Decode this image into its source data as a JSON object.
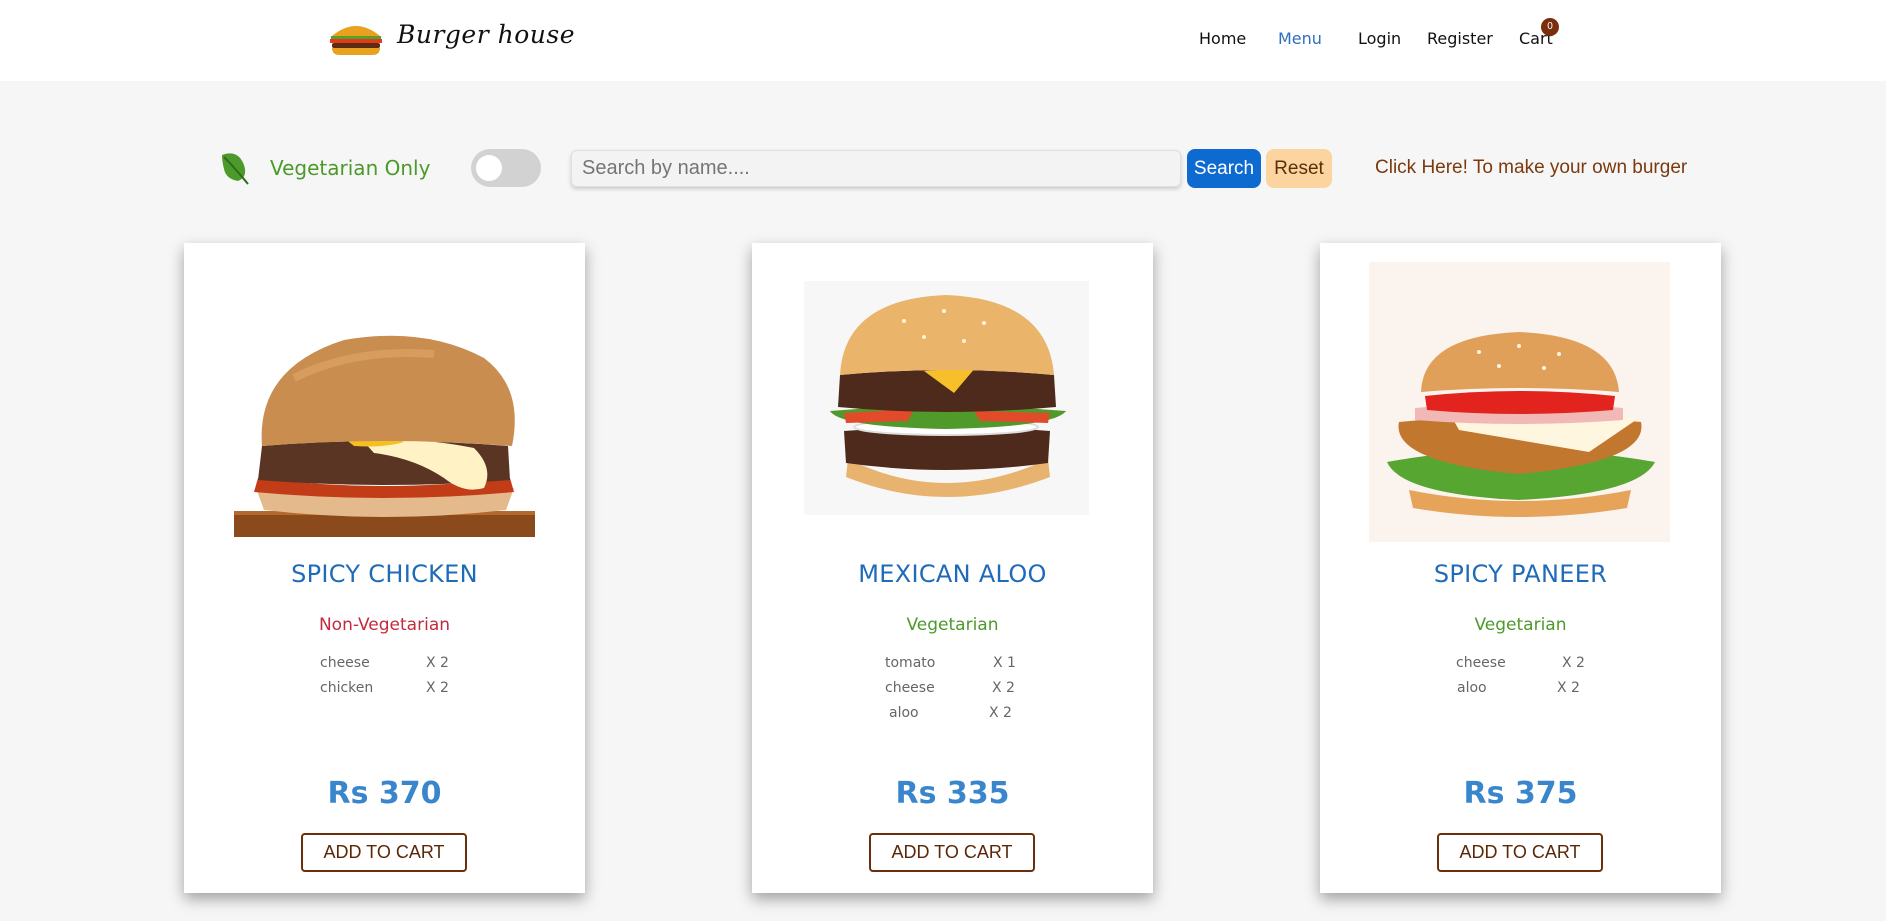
{
  "header": {
    "brand": "Burger house",
    "nav": {
      "home": "Home",
      "menu": "Menu",
      "login": "Login",
      "register": "Register",
      "cart": "Cart",
      "cart_count": "0"
    }
  },
  "filter": {
    "veg_label": "Vegetarian Only",
    "veg_toggle_on": false,
    "search_placeholder": "Search by name....",
    "search_label": "Search",
    "reset_label": "Reset",
    "custom_link": "Click Here! To make your own burger"
  },
  "products": [
    {
      "name": "SPICY CHICKEN",
      "type": "Non-Vegetarian",
      "ingredients": [
        {
          "name": "cheese",
          "qty": "X 2"
        },
        {
          "name": "chicken",
          "qty": "X 2"
        }
      ],
      "price": "Rs 370",
      "button": "ADD TO CART"
    },
    {
      "name": "MEXICAN ALOO",
      "type": "Vegetarian",
      "ingredients": [
        {
          "name": "tomato",
          "qty": "X 1"
        },
        {
          "name": "cheese",
          "qty": "X 2"
        },
        {
          "name": "aloo",
          "qty": "X 2"
        }
      ],
      "price": "Rs 335",
      "button": "ADD TO CART"
    },
    {
      "name": "SPICY PANEER",
      "type": "Vegetarian",
      "ingredients": [
        {
          "name": "cheese",
          "qty": "X 2"
        },
        {
          "name": "aloo",
          "qty": "X 2"
        }
      ],
      "price": "Rs 375",
      "button": "ADD TO CART"
    }
  ],
  "colors": {
    "primary": "#0d6ad0",
    "title": "#1f6bb8",
    "price": "#3a86cc",
    "veg": "#4b9a2b",
    "nonveg": "#c22a3e",
    "accent_brown": "#6b2e0d",
    "reset_bg": "#fcd4a0"
  }
}
